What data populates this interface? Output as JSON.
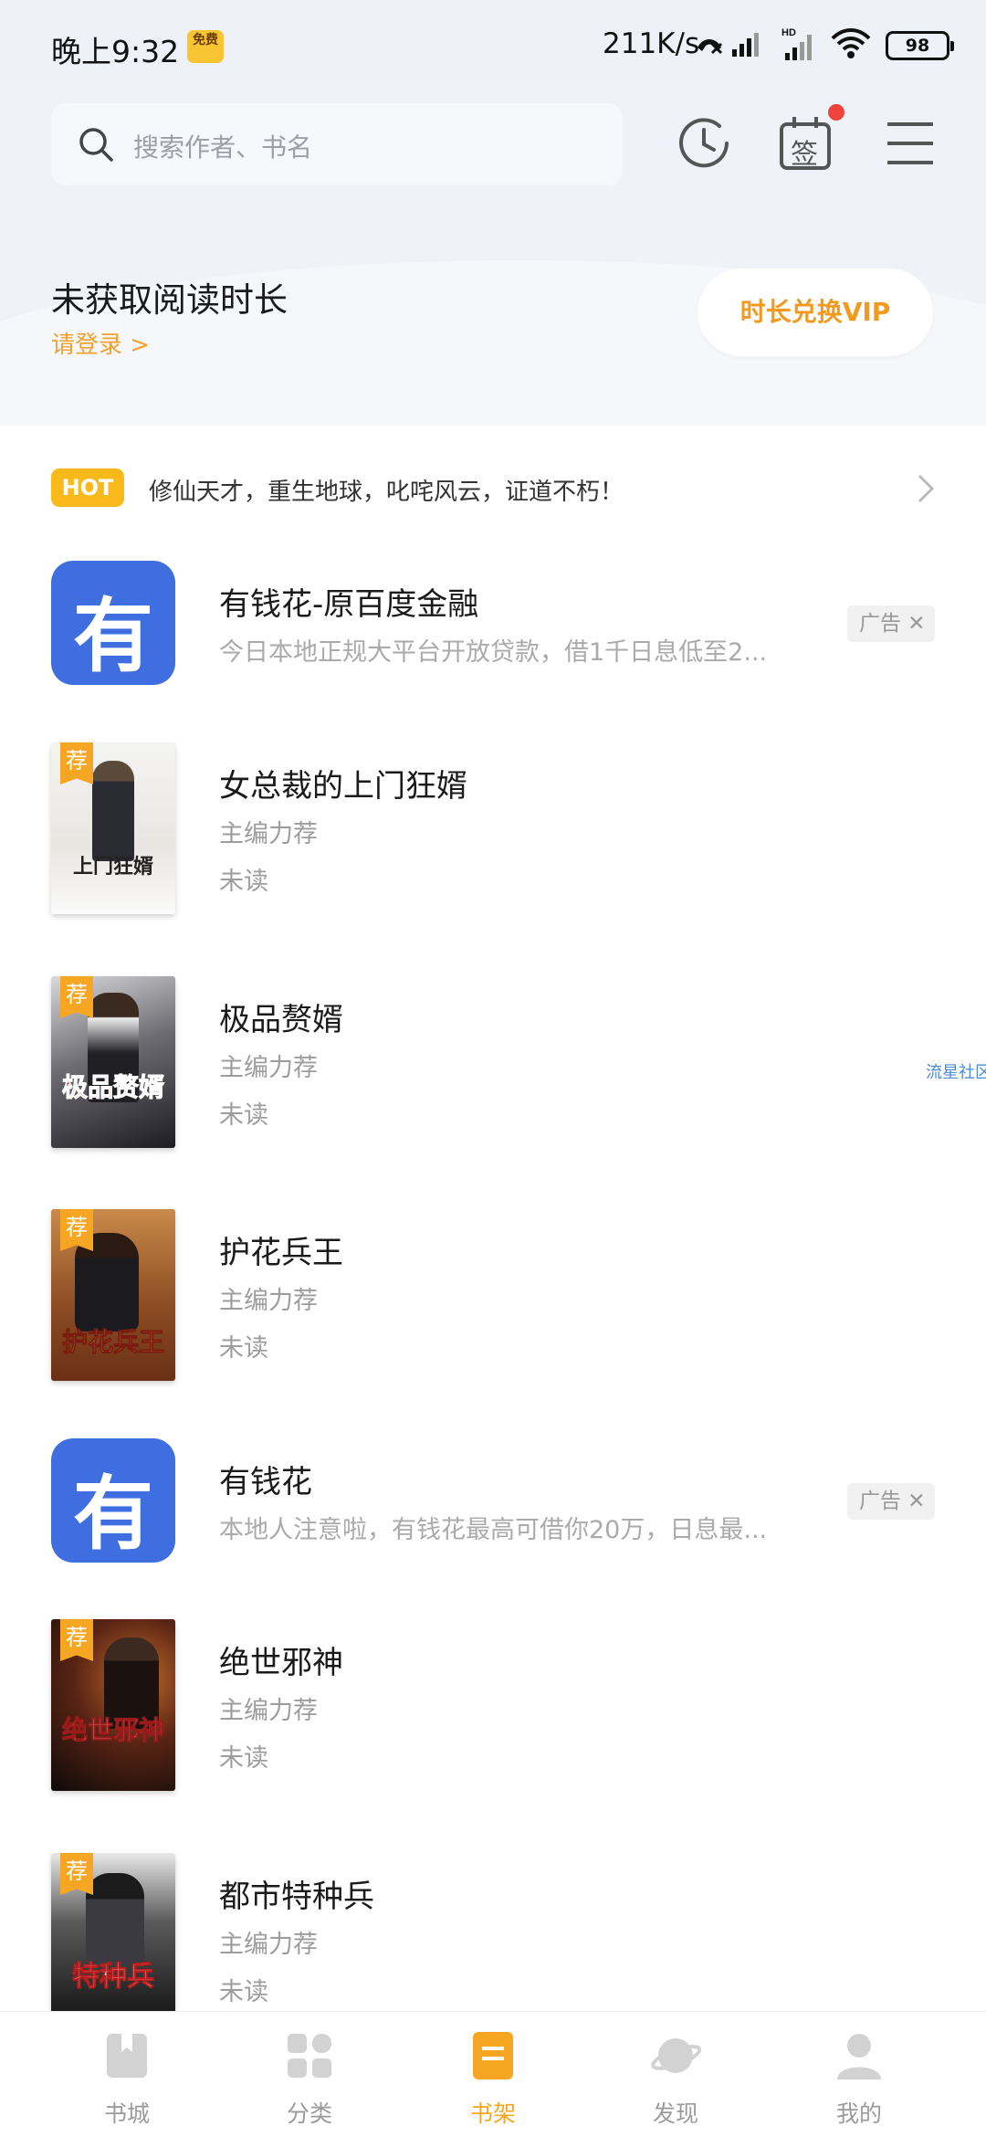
{
  "status_bar": {
    "time": "晚上9:32",
    "badge": "免费",
    "net_speed": "211K/s",
    "battery": "98"
  },
  "search": {
    "placeholder": "搜索作者、书名"
  },
  "header_icons": {
    "history": "clock-icon",
    "sign": "签",
    "menu": "menu-icon"
  },
  "reading": {
    "title": "未获取阅读时长",
    "login": "请登录 >",
    "vip_button": "时长兑换VIP"
  },
  "hot": {
    "tag": "HOT",
    "text": "修仙天才，重生地球，叱咤风云，证道不朽！"
  },
  "ad_label": "广告 ✕",
  "side_label": "流星社区",
  "items": [
    {
      "type": "ad",
      "title": "有钱花-原百度金融",
      "desc": "今日本地正规大平台开放贷款，借1千日息低至2...",
      "logo": "有"
    },
    {
      "type": "book",
      "title": "女总裁的上门狂婿",
      "sub": "主编力荐",
      "status": "未读",
      "tag": "荐",
      "cover_text": "上门狂婿"
    },
    {
      "type": "book",
      "title": "极品赘婿",
      "sub": "主编力荐",
      "status": "未读",
      "tag": "荐",
      "cover_text": "极品赘婿"
    },
    {
      "type": "book",
      "title": "护花兵王",
      "sub": "主编力荐",
      "status": "未读",
      "tag": "荐",
      "cover_text": "护花兵王"
    },
    {
      "type": "ad",
      "title": "有钱花",
      "desc": "本地人注意啦，有钱花最高可借你20万，日息最...",
      "logo": "有"
    },
    {
      "type": "book",
      "title": "绝世邪神",
      "sub": "主编力荐",
      "status": "未读",
      "tag": "荐",
      "cover_text": "绝世邪神"
    },
    {
      "type": "book",
      "title": "都市特种兵",
      "sub": "主编力荐",
      "status": "未读",
      "tag": "荐",
      "cover_text": "特种兵"
    }
  ],
  "nav": [
    {
      "label": "书城",
      "icon": "bookstore-icon"
    },
    {
      "label": "分类",
      "icon": "category-icon"
    },
    {
      "label": "书架",
      "icon": "bookshelf-icon",
      "active": true
    },
    {
      "label": "发现",
      "icon": "discover-icon"
    },
    {
      "label": "我的",
      "icon": "profile-icon"
    }
  ],
  "colors": {
    "accent": "#f6a623",
    "ad_blue": "#3f6ee0",
    "bg_top": "#eef1f7"
  }
}
